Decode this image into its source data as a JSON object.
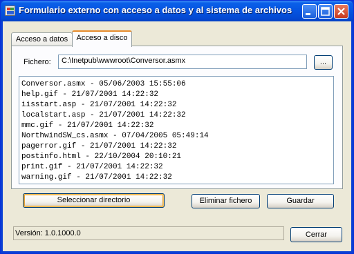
{
  "window": {
    "title": "Formulario externo con acceso a datos y al sistema de archivos",
    "min_icon": "minimize-icon",
    "max_icon": "maximize-icon",
    "close_icon": "close-icon"
  },
  "tabs": [
    {
      "label": "Acceso a datos",
      "selected": false
    },
    {
      "label": "Acceso a disco",
      "selected": true
    }
  ],
  "file": {
    "label": "Fichero:",
    "value": "C:\\Inetpub\\wwwroot\\Conversor.asmx",
    "browse_label": "..."
  },
  "files": [
    "Conversor.asmx - 05/06/2003 15:55:06",
    "help.gif - 21/07/2001 14:22:32",
    "iisstart.asp - 21/07/2001 14:22:32",
    "localstart.asp - 21/07/2001 14:22:32",
    "mmc.gif - 21/07/2001 14:22:32",
    "NorthwindSW_cs.asmx - 07/04/2005 05:49:14",
    "pagerror.gif - 21/07/2001 14:22:32",
    "postinfo.html - 22/10/2004 20:10:21",
    "print.gif - 21/07/2001 14:22:32",
    "warning.gif - 21/07/2001 14:22:32"
  ],
  "buttons": {
    "select_dir": "Seleccionar directorio",
    "delete_file": "Eliminar fichero",
    "save": "Guardar",
    "close": "Cerrar"
  },
  "status": {
    "version": "Versión: 1.0.1000.0"
  },
  "colors": {
    "titlebar": "#0553e0",
    "focus_accent": "#e68b2c",
    "face": "#ece9d8"
  }
}
